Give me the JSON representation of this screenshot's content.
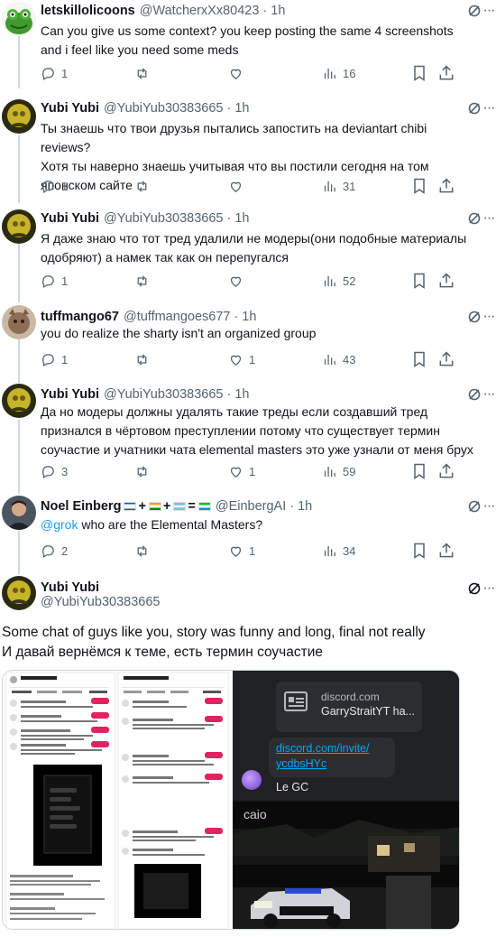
{
  "tweets": [
    {
      "name": "letskillolicoons",
      "handle": "@WatcherxXx80423",
      "time": "1h",
      "text_lines": [
        "Can you give us some context? you keep posting the same 4 screenshots",
        "and i feel like you need some meds"
      ],
      "replies": "1",
      "retweets": "",
      "likes": "",
      "views": "16"
    },
    {
      "name": "Yubi Yubi",
      "handle": "@YubiYub30383665",
      "time": "1h",
      "text_lines": [
        "Ты знаешь что твои друзья пытались запостить на deviantart chibi reviews?",
        "Хотя ты наверно знаешь учитывая что вы постили сегодня на том",
        "японском сайте"
      ],
      "replies": "1",
      "retweets": "",
      "likes": "",
      "views": "31"
    },
    {
      "name": "Yubi Yubi",
      "handle": "@YubiYub30383665",
      "time": "1h",
      "text_lines": [
        "Я даже знаю что тот тред удалили не модеры(они подобные материалы",
        "одобряют) а намек так как он перепугался"
      ],
      "replies": "1",
      "retweets": "",
      "likes": "",
      "views": "52"
    },
    {
      "name": "tuffmango67",
      "handle": "@tuffmangoes677",
      "time": "1h",
      "text_lines": [
        "you do realize the sharty isn't an organized group"
      ],
      "replies": "1",
      "retweets": "",
      "likes": "1",
      "views": "43"
    },
    {
      "name": "Yubi Yubi",
      "handle": "@YubiYub30383665",
      "time": "1h",
      "text_lines": [
        "Да но модеры должны удалять такие треды если создавший тред",
        "признался в чёртовом преступлении потому что существует термин",
        "соучастие и учатники чата elemental masters это уже узнали от меня брух"
      ],
      "replies": "3",
      "retweets": "",
      "likes": "1",
      "views": "59"
    },
    {
      "name": "Noel Einberg",
      "handle": "@EinbergAI",
      "time": "1h",
      "mention": "@grok",
      "text_rest": " who are the Elemental Masters?",
      "flag_separators": [
        "+",
        "+",
        "="
      ],
      "replies": "2",
      "retweets": "",
      "likes": "1",
      "views": "34"
    }
  ],
  "main_tweet": {
    "name": "Yubi Yubi",
    "handle": "@YubiYub30383665",
    "text_line1": "Some chat of guys like you, story was funny and long, final not really",
    "text_line2": "И давай вернёмся к теме, есть термин соучастие"
  },
  "media": {
    "left_profile_name": "clovelfbearml",
    "tabs": [
      "Verified Followers",
      "Followers you know",
      "Followers",
      "Following"
    ],
    "follow_label": "Follow",
    "discord_domain": "discord.com",
    "discord_server": "GarryStraitYT ha...",
    "invite_link_line1": "discord.com/invite/",
    "invite_link_line2": "ycdbsHYc",
    "reply_text": "Le GC",
    "photo_caption": "caio"
  },
  "icons": {
    "reply": "reply-icon",
    "retweet": "retweet-icon",
    "like": "heart-icon",
    "views": "views-icon",
    "bookmark": "bookmark-icon",
    "share": "share-icon",
    "grok": "grok-icon",
    "more": "more-icon"
  },
  "colors": {
    "accent": "#1d9bf0",
    "muted": "#536471",
    "thread_line": "#cfd9de"
  }
}
